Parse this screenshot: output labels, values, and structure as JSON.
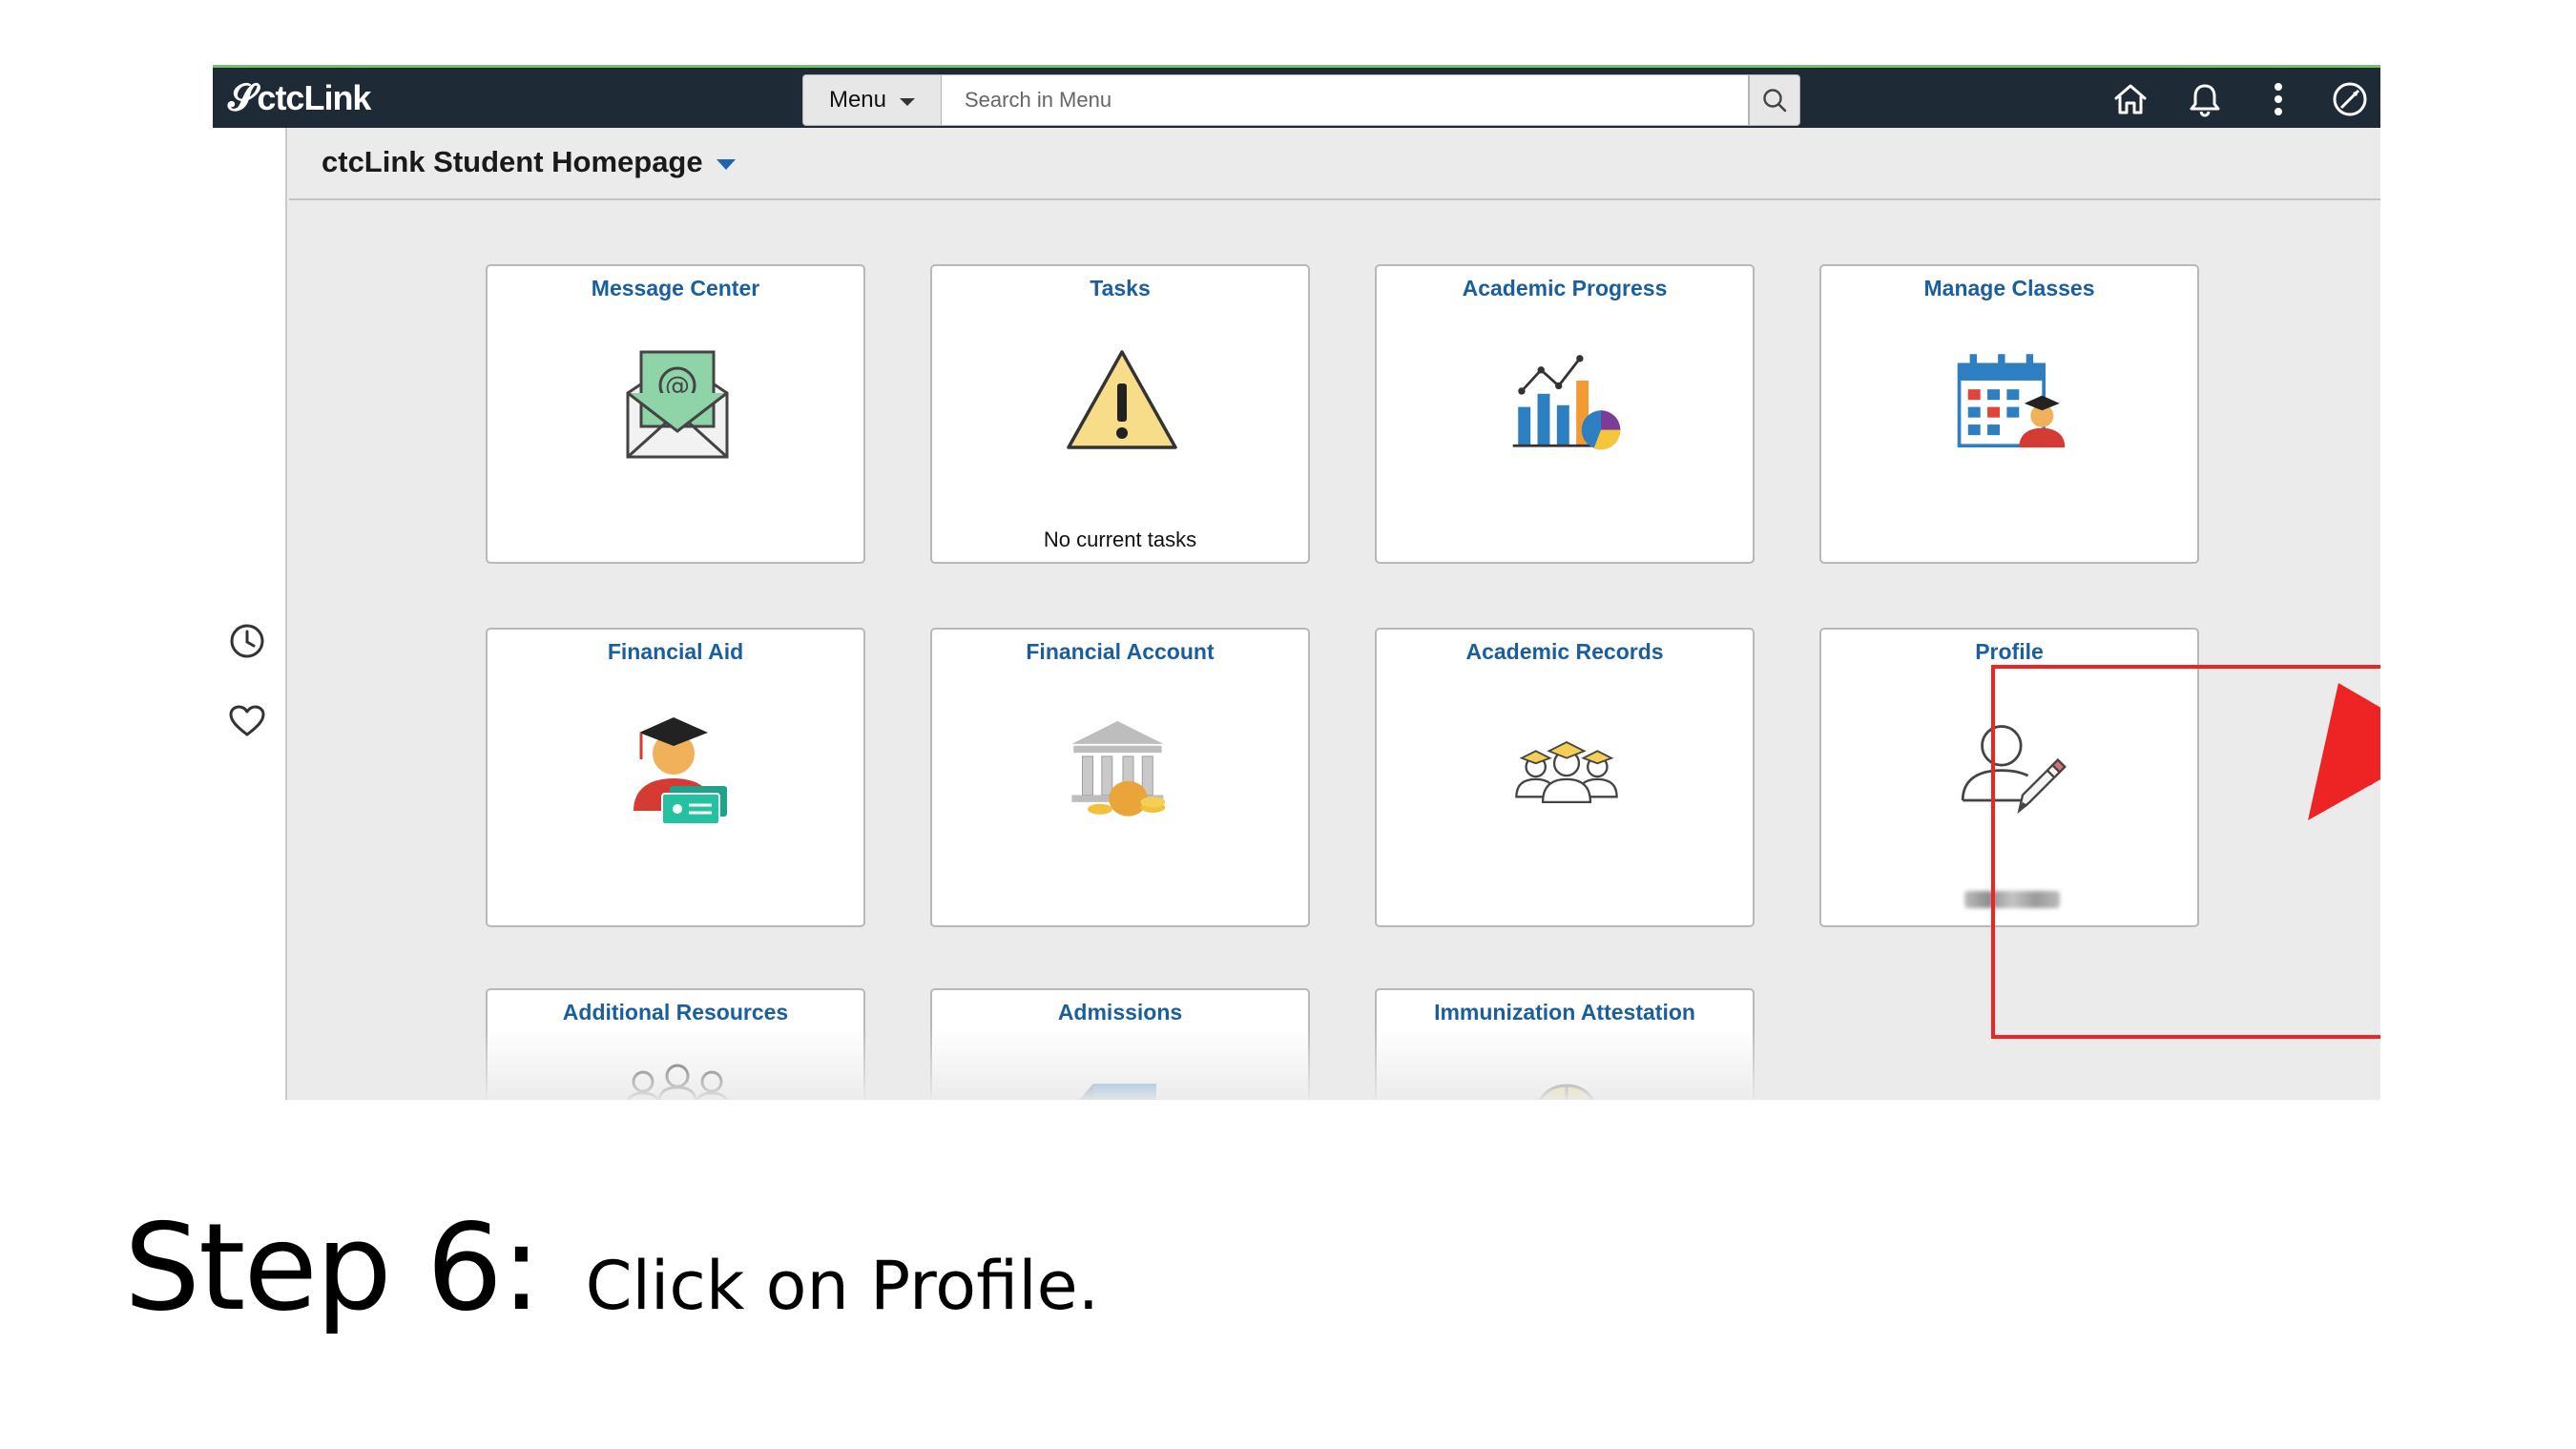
{
  "topbar": {
    "logo_text": "ctcLink",
    "menu_label": "Menu",
    "search_placeholder": "Search in Menu",
    "icons": [
      "home-icon",
      "bell-icon",
      "more-vertical-icon",
      "compass-icon"
    ]
  },
  "sidebar": {
    "icons": [
      "recent-clock-icon",
      "favorites-heart-icon"
    ]
  },
  "page": {
    "title": "ctcLink Student Homepage"
  },
  "tiles": [
    {
      "title": "Message Center",
      "icon": "envelope-at-icon",
      "subtitle": ""
    },
    {
      "title": "Tasks",
      "icon": "warning-icon",
      "subtitle": "No current tasks"
    },
    {
      "title": "Academic Progress",
      "icon": "chart-icon",
      "subtitle": ""
    },
    {
      "title": "Manage Classes",
      "icon": "calendar-student-icon",
      "subtitle": ""
    },
    {
      "title": "Financial Aid",
      "icon": "graduate-money-icon",
      "subtitle": ""
    },
    {
      "title": "Financial Account",
      "icon": "bank-icon",
      "subtitle": ""
    },
    {
      "title": "Academic Records",
      "icon": "graduates-group-icon",
      "subtitle": ""
    },
    {
      "title": "Profile",
      "icon": "user-edit-icon",
      "subtitle": ""
    },
    {
      "title": "Additional Resources",
      "icon": "people-icon",
      "subtitle": ""
    },
    {
      "title": "Admissions",
      "icon": "folder-icon",
      "subtitle": ""
    },
    {
      "title": "Immunization Attestation",
      "icon": "hardhat-icon",
      "subtitle": ""
    }
  ],
  "colors": {
    "topbar": "#1f2a37",
    "tile_title": "#1b5e9e",
    "highlight": "#ee2424"
  },
  "caption": {
    "step": "Step 6:",
    "text": "Click on Profile."
  }
}
